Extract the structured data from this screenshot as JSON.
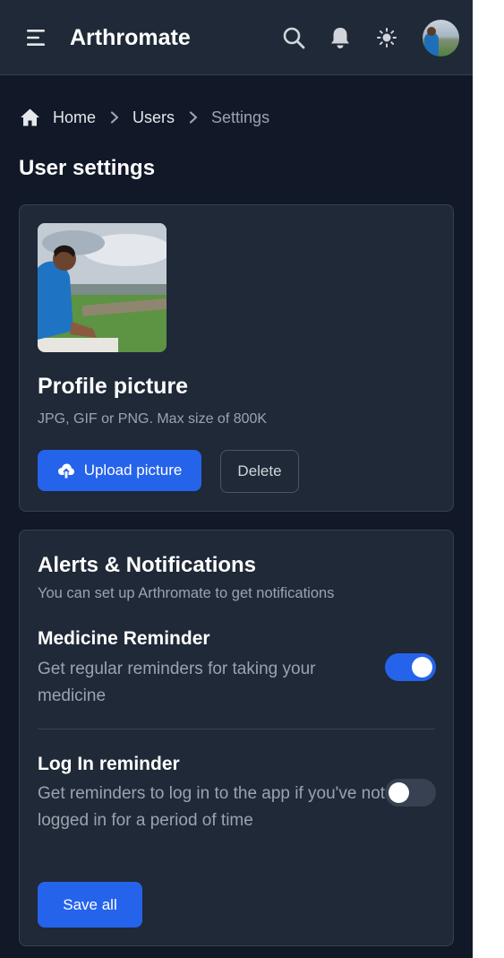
{
  "app": {
    "title": "Arthromate"
  },
  "breadcrumb": {
    "home": "Home",
    "users": "Users",
    "current": "Settings"
  },
  "page": {
    "title": "User settings"
  },
  "profile": {
    "title": "Profile picture",
    "hint": "JPG, GIF or PNG. Max size of 800K",
    "upload_label": "Upload picture",
    "delete_label": "Delete"
  },
  "alerts": {
    "title": "Alerts & Notifications",
    "subtitle": "You can set up Arthromate to get notifications",
    "items": [
      {
        "title": "Medicine Reminder",
        "desc": "Get regular reminders for taking your medicine",
        "enabled": true
      },
      {
        "title": "Log In reminder",
        "desc": "Get reminders to log in to the app if you've not logged in for a period of time",
        "enabled": false
      }
    ],
    "save_label": "Save all"
  },
  "colors": {
    "accent": "#2563eb",
    "background": "#111827",
    "surface": "#1f2937"
  }
}
